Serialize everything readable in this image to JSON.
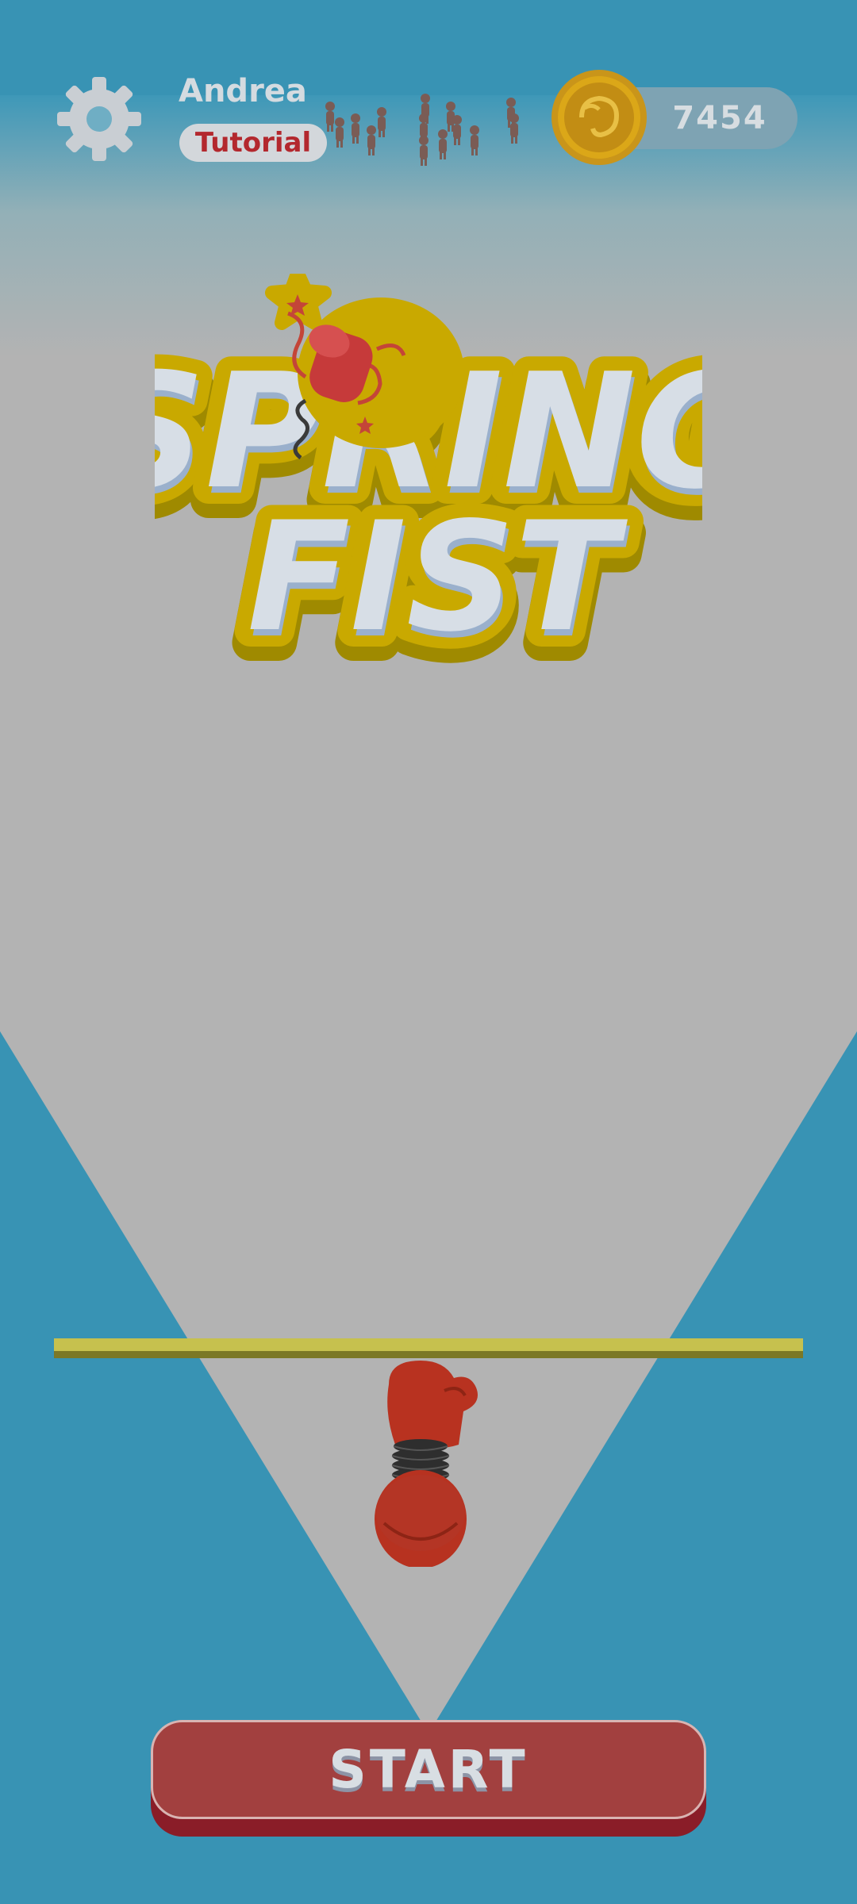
{
  "header": {
    "player_name": "Andrea",
    "level_label": "Tutorial",
    "coin_count": "7454"
  },
  "logo": {
    "line1": "SPRING",
    "line2": "FIST"
  },
  "start_button": {
    "label": "START"
  },
  "icons": {
    "settings": "gear-icon",
    "coin": "coin-icon",
    "crowd": "crowd-icon",
    "fist": "boxing-glove-icon"
  },
  "colors": {
    "background": "#3893b4",
    "floor": "#b3b3b3",
    "start_button": "#a2403f",
    "logo_outline": "#c9a900",
    "coin": "#d9a716"
  }
}
